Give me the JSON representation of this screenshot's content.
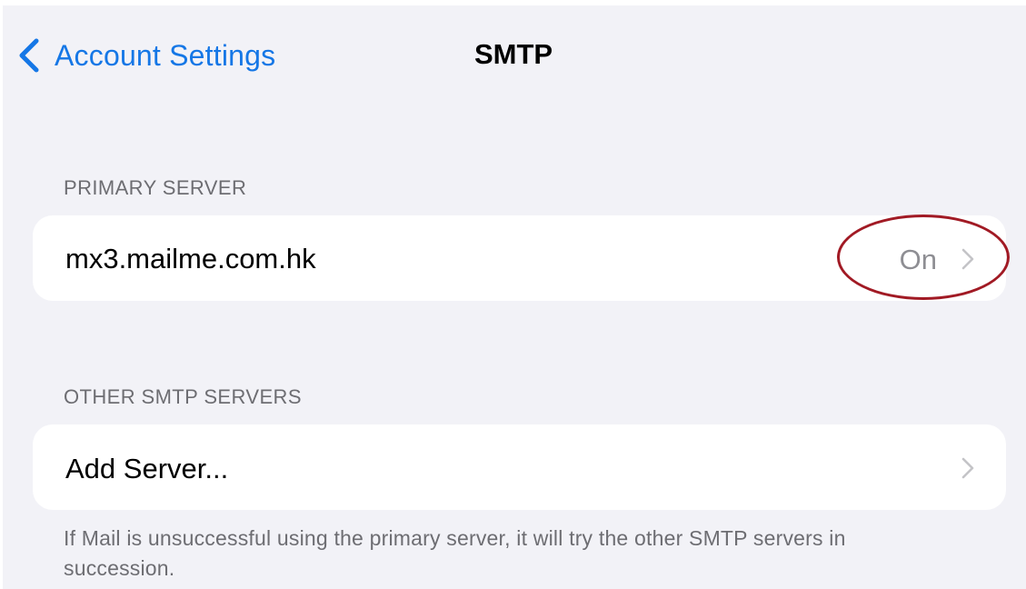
{
  "nav": {
    "back_label": "Account Settings",
    "title": "SMTP"
  },
  "primary_section": {
    "header": "PRIMARY SERVER",
    "server": {
      "label": "mx3.mailme.com.hk",
      "status": "On"
    }
  },
  "other_section": {
    "header": "OTHER SMTP SERVERS",
    "add_label": "Add Server...",
    "footer": "If Mail is unsuccessful using the primary server, it will try the other SMTP servers in succession."
  },
  "icons": {
    "back": "chevron-left-icon",
    "disclosure": "chevron-right-icon"
  },
  "colors": {
    "accent": "#1577e6",
    "background": "#f2f2f7",
    "secondary_text": "#8e8e93",
    "annotation": "#a11a24"
  }
}
